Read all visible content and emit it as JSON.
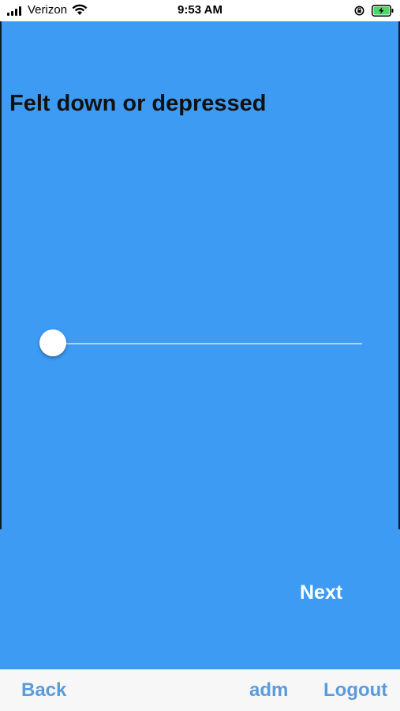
{
  "status_bar": {
    "carrier": "Verizon",
    "time": "9:53 AM",
    "icons": [
      "signal-bars-icon",
      "wifi-icon",
      "orientation-lock-icon",
      "battery-charging-icon"
    ]
  },
  "question": {
    "title": "Felt down or depressed",
    "slider_value": 0
  },
  "actions": {
    "next_label": "Next"
  },
  "toolbar": {
    "back_label": "Back",
    "user_label": "adm",
    "logout_label": "Logout"
  },
  "colors": {
    "panel_blue": "#3d9bf4",
    "toolbar_text": "#5a9bdc",
    "battery_green": "#4cd964"
  }
}
